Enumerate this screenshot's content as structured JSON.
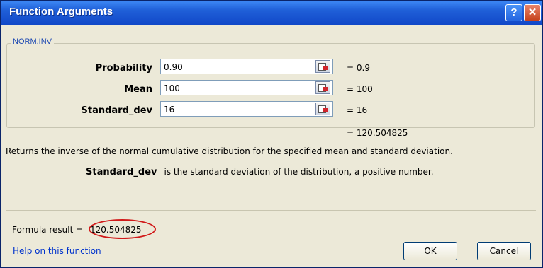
{
  "window": {
    "title": "Function Arguments",
    "help_glyph": "?",
    "close_glyph": "✕"
  },
  "function_name": "NORM.INV",
  "arguments": [
    {
      "label": "Probability",
      "value": "0.90",
      "result": "=  0.9"
    },
    {
      "label": "Mean",
      "value": "100",
      "result": "=  100"
    },
    {
      "label": "Standard_dev",
      "value": "16",
      "result": "=  16"
    }
  ],
  "overall_result": "=  120.504825",
  "description": "Returns the inverse of the normal cumulative distribution for the specified mean and standard deviation.",
  "arg_help": {
    "name": "Standard_dev",
    "text": "is the standard deviation of the distribution, a positive number."
  },
  "formula_result": {
    "label": "Formula result =",
    "value": "120.504825"
  },
  "help_link": "Help on this function",
  "buttons": {
    "ok": "OK",
    "cancel": "Cancel"
  },
  "colors": {
    "title_bar": "#1f5fd8",
    "highlight_oval": "#d11a1a",
    "link": "#0033cc"
  },
  "icons": {
    "ref_button": "collapse-dialog-icon"
  }
}
